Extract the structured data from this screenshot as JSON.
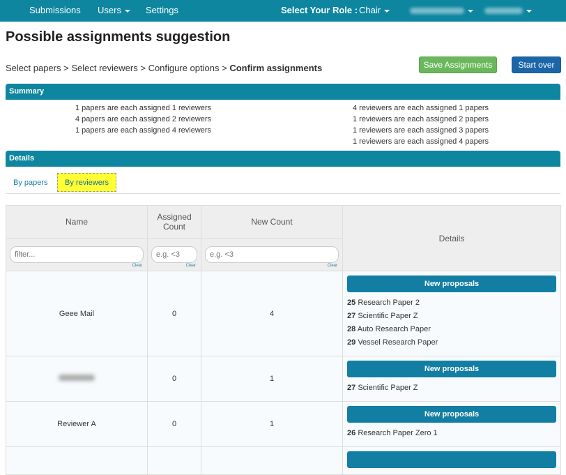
{
  "nav": {
    "submissions": "Submissions",
    "users": "Users",
    "settings": "Settings",
    "role_label": "Select Your Role :",
    "role_value": "Chair"
  },
  "page": {
    "title": "Possible assignments suggestion",
    "breadcrumb": {
      "steps": [
        "Select papers",
        "Select reviewers",
        "Configure options"
      ],
      "separator": ">",
      "current": "Confirm assignments"
    },
    "save_label": "Save Assignments",
    "start_over_label": "Start over"
  },
  "summary": {
    "title": "Summary",
    "left": [
      "1 papers are each assigned 1 reviewers",
      "4 papers are each assigned 2 reviewers",
      "1 papers are each assigned 4 reviewers"
    ],
    "right": [
      "4 reviewers are each assigned 1 papers",
      "1 reviewers are each assigned 2 papers",
      "1 reviewers are each assigned 3 papers",
      "1 reviewers are each assigned 4 papers"
    ]
  },
  "details": {
    "title": "Details",
    "tabs": {
      "by_papers": "By papers",
      "by_reviewers": "By reviewers"
    },
    "table": {
      "headers": {
        "name": "Name",
        "assigned": "Assigned Count",
        "new": "New Count",
        "details": "Details"
      },
      "filters": {
        "name_placeholder": "filter...",
        "assigned_placeholder": "e.g. <3",
        "new_placeholder": "e.g. <3",
        "clear": "Clear"
      },
      "proposal_label": "New proposals",
      "rows": [
        {
          "name": "Geee Mail",
          "assigned": "0",
          "new": "4",
          "papers": [
            {
              "id": "25",
              "title": "Research Paper 2"
            },
            {
              "id": "27",
              "title": "Scientific Paper Z"
            },
            {
              "id": "28",
              "title": "Auto Research Paper"
            },
            {
              "id": "29",
              "title": "Vessel Research Paper"
            }
          ]
        },
        {
          "name": "",
          "assigned": "0",
          "new": "1",
          "papers": [
            {
              "id": "27",
              "title": "Scientific Paper Z"
            }
          ]
        },
        {
          "name": "Reviewer A",
          "assigned": "0",
          "new": "1",
          "papers": [
            {
              "id": "26",
              "title": "Research Paper Zero 1"
            }
          ]
        }
      ]
    }
  },
  "colors": {
    "primary_bar": "#0e86a0",
    "save_button": "#6bb85c",
    "start_over_button": "#1b66a8",
    "active_tab_highlight": "#ffff33"
  }
}
